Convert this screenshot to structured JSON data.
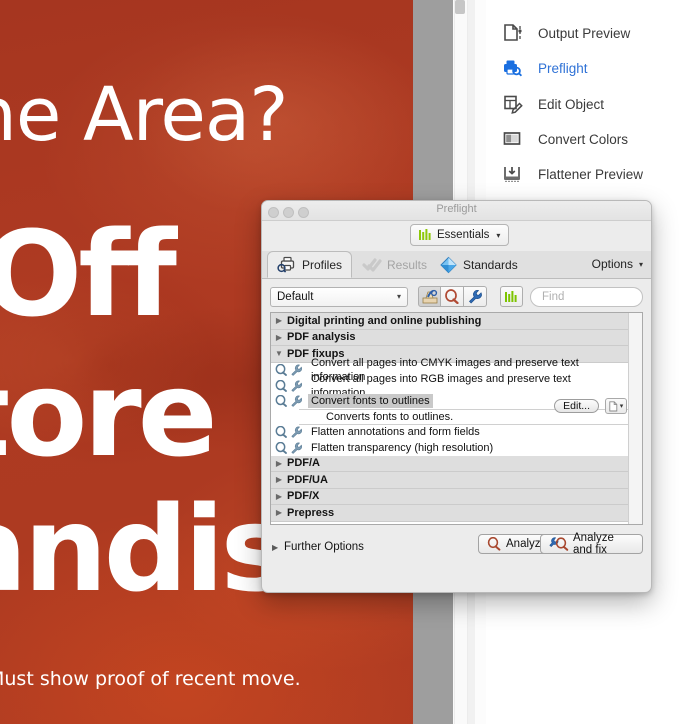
{
  "poster": {
    "headline": "ne Area?",
    "line_off": "Off",
    "line_store": "tore",
    "line_andise": "andis",
    "fine_print": "Must show proof of recent move."
  },
  "sidebar": {
    "items": [
      {
        "label": "Output Preview",
        "icon": "output-preview-icon",
        "active": false
      },
      {
        "label": "Preflight",
        "icon": "preflight-icon",
        "active": true
      },
      {
        "label": "Edit Object",
        "icon": "edit-object-icon",
        "active": false
      },
      {
        "label": "Convert Colors",
        "icon": "convert-colors-icon",
        "active": false
      },
      {
        "label": "Flattener Preview",
        "icon": "flattener-preview-icon",
        "active": false
      }
    ]
  },
  "dialog": {
    "title": "Preflight",
    "essentials": {
      "label": "Essentials",
      "icon": "green-bars-icon",
      "caret": "▾"
    },
    "tabs": [
      {
        "label": "Profiles",
        "icon": "profiles-printer-icon",
        "active": true
      },
      {
        "label": "Results",
        "icon": "results-checkmarks-icon",
        "active": false
      },
      {
        "label": "Standards",
        "icon": "standards-diamond-icon",
        "active": false
      }
    ],
    "options": {
      "label": "Options",
      "caret": "▾"
    },
    "toolbar": {
      "profile_value": "Default",
      "profile_caret": "▾",
      "buttons": [
        {
          "name": "hand-pick-icon",
          "pressed": true
        },
        {
          "name": "magnifier-icon",
          "pressed": false
        },
        {
          "name": "wrench-icon",
          "pressed": false
        }
      ],
      "chart_button": "green-bars-icon",
      "find_placeholder": "Find"
    },
    "list": [
      {
        "type": "group",
        "label": "Digital printing and online publishing",
        "expanded": false,
        "tri": "▶"
      },
      {
        "type": "group",
        "label": "PDF analysis",
        "expanded": false,
        "tri": "▶"
      },
      {
        "type": "group",
        "label": "PDF fixups",
        "expanded": true,
        "tri": "▼"
      },
      {
        "type": "fixup",
        "label": "Convert all pages into CMYK images and preserve text information",
        "selected": false
      },
      {
        "type": "fixup",
        "label": "Convert all pages into RGB images and preserve text information",
        "selected": false
      },
      {
        "type": "fixup",
        "label": "Convert fonts to outlines",
        "selected": true
      },
      {
        "type": "description",
        "label": "Converts fonts to outlines."
      },
      {
        "type": "fixup",
        "label": "Flatten annotations and form fields",
        "selected": false
      },
      {
        "type": "fixup",
        "label": "Flatten transparency (high resolution)",
        "selected": false
      },
      {
        "type": "group",
        "label": "PDF/A",
        "expanded": false,
        "tri": "▶"
      },
      {
        "type": "group",
        "label": "PDF/UA",
        "expanded": false,
        "tri": "▶"
      },
      {
        "type": "group",
        "label": "PDF/X",
        "expanded": false,
        "tri": "▶"
      },
      {
        "type": "group",
        "label": "Prepress",
        "expanded": false,
        "tri": "▶"
      }
    ],
    "edit_button": "Edit...",
    "footer": {
      "further_options": "Further Options",
      "further_tri": "▶",
      "analyze": "Analyze",
      "analyze_and_fix": "Analyze and fix"
    }
  },
  "colors": {
    "poster_orange": "#ad3a21",
    "accent_blue": "#2f72d6",
    "dialog_bg": "#ececec",
    "selection_gray": "#c9c9c9",
    "green_bars": "#7dc400"
  }
}
